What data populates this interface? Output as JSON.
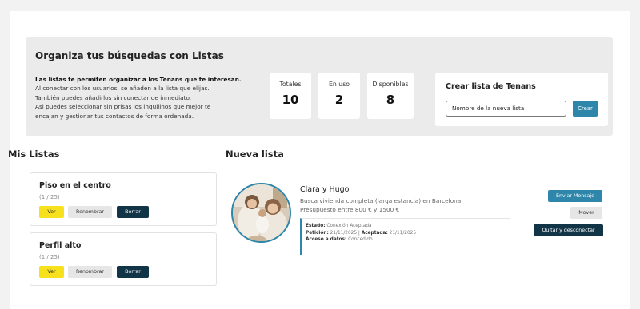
{
  "header": {
    "title": "Organiza tus búsquedas con Listas",
    "intro": {
      "lead": "Las listas te permiten organizar a los Tenans que te interesan.",
      "lines": [
        "Al conectar con los usuarios, se añaden a la lista que elijas.",
        "También puedes añadirlos sin conectar de inmediato.",
        "Asi puedes seleccionar sin prisas los inquilinos que mejor te",
        "encajan y gestionar tus contactos de forma ordenada."
      ]
    },
    "stats": [
      {
        "label": "Totales",
        "value": "10"
      },
      {
        "label": "En uso",
        "value": "2"
      },
      {
        "label": "Disponibles",
        "value": "8"
      }
    ],
    "create": {
      "title": "Crear lista de Tenans",
      "input_value": "Nombre de la nueva lista",
      "button": "Crear"
    }
  },
  "my_lists": {
    "title": "Mis Listas",
    "lists": [
      {
        "name": "Piso en el centro",
        "count": "(1 / 25)",
        "ver": "Ver",
        "rename": "Renombrar",
        "delete": "Borrar"
      },
      {
        "name": "Perfil alto",
        "count": "(1 / 25)",
        "ver": "Ver",
        "rename": "Renombrar",
        "delete": "Borrar"
      }
    ]
  },
  "new_list": {
    "title": "Nueva lista",
    "tenant": {
      "name": "Clara y Hugo",
      "description": "Busca vivienda completa (larga estancia) en Barcelona",
      "budget": "Presupuesto entre 800 € y 1500 €",
      "estado_label": "Estado:",
      "estado_value": "Conexión Aceptada",
      "peticion_label": "Petición:",
      "peticion_value": "21/11/2025",
      "aceptada_label": "Aceptada:",
      "aceptada_value": "21/11/2025",
      "acceso_label": "Acceso a datos:",
      "acceso_value": "Concedido",
      "avatar_icon": "family-photo"
    },
    "actions": {
      "message": "Enviar Mensaje",
      "move": "Mover",
      "disconnect": "Quitar y desconectar"
    }
  },
  "colors": {
    "accent": "#2e86ab",
    "dark": "#123447",
    "yellow": "#f7e11d",
    "panel": "#ebebeb"
  }
}
